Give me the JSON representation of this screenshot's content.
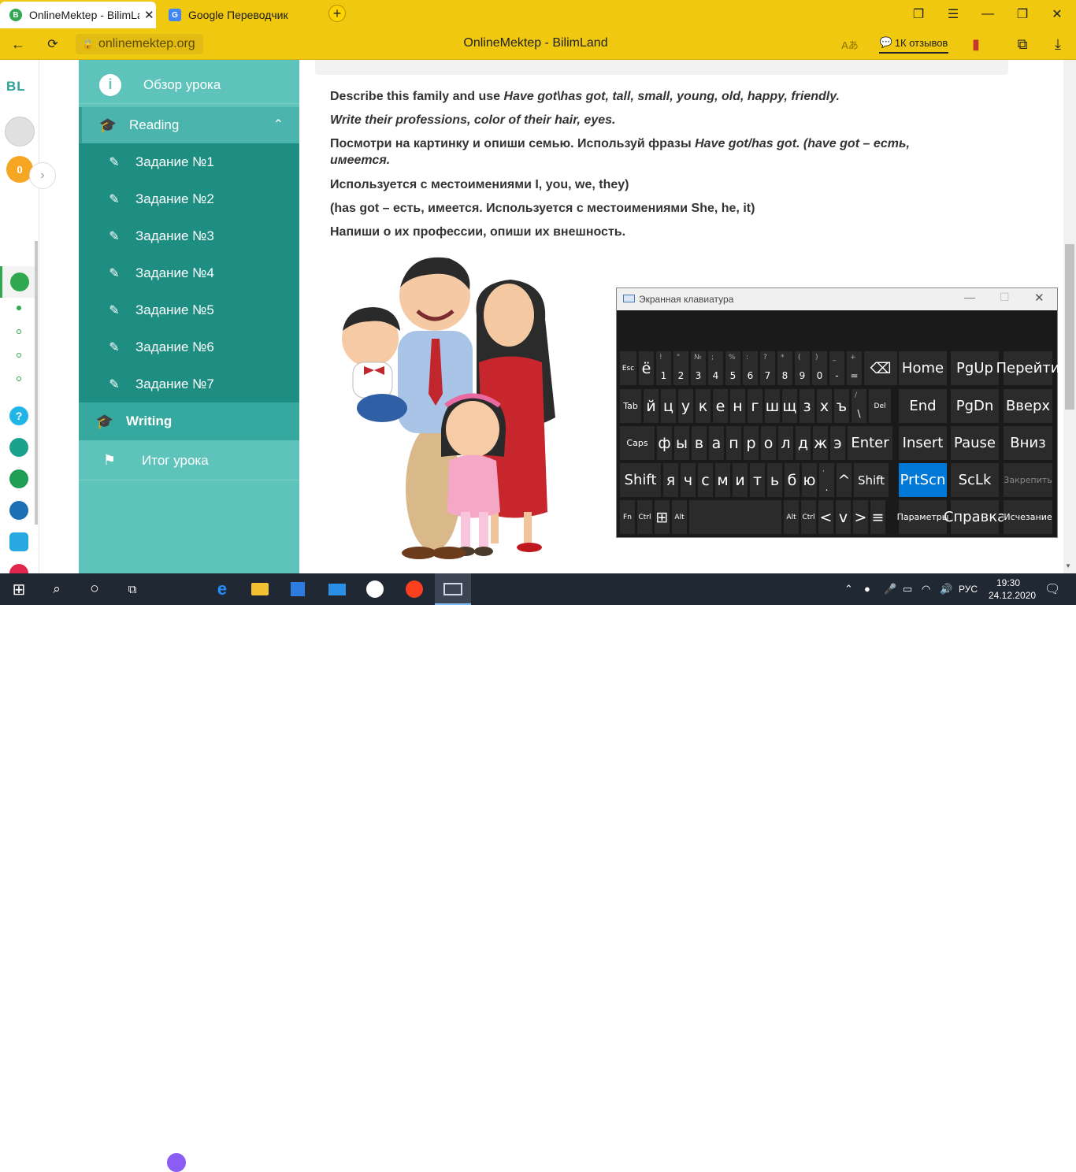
{
  "browser": {
    "tabs": [
      {
        "title": "OnlineMektep - BilimLand",
        "active": true
      },
      {
        "title": "Google Переводчик",
        "active": false
      }
    ],
    "url": "onlinemektep.org",
    "page_title": "OnlineMektep - BilimLand",
    "reviews_label": "1К отзывов"
  },
  "app_sidebar": {
    "logo": "BL",
    "score": "0"
  },
  "menu": {
    "overview": "Обзор урока",
    "reading": "Reading",
    "tasks": [
      "Задание №1",
      "Задание №2",
      "Задание №3",
      "Задание №4",
      "Задание №5",
      "Задание №6",
      "Задание №7"
    ],
    "writing": "Writing",
    "summary": "Итог урока"
  },
  "content": {
    "line1_prefix": "Describe this family and use ",
    "line1_italic": "Have got\\has got, tall, small, young, old, happy, friendly.",
    "line2_italic": "Write their professions, color of their hair, eyes.",
    "line3_prefix": "Посмотри на картинку и опиши семью. Используй фразы ",
    "line3_italic": "Have got/has got. (have got – есть, имеется.",
    "line4": "Используется с местоимениями I, you, we, they)",
    "line5": "(has got – есть, имеется. Используется с местоимениями She, he, it)",
    "line6": "Напиши о их профессии, опиши их внешность."
  },
  "osk": {
    "title": "Экранная клавиатура",
    "row1": [
      {
        "main": "Esc",
        "size": "s"
      },
      {
        "main": "ё",
        "size": "l"
      },
      {
        "main": "1",
        "sup": "!"
      },
      {
        "main": "2",
        "sup": "\""
      },
      {
        "main": "3",
        "sup": "№"
      },
      {
        "main": "4",
        "sup": ";"
      },
      {
        "main": "5",
        "sup": "%"
      },
      {
        "main": "6",
        "sup": ":"
      },
      {
        "main": "7",
        "sup": "?"
      },
      {
        "main": "8",
        "sup": "*"
      },
      {
        "main": "9",
        "sup": "("
      },
      {
        "main": "0",
        "sup": ")"
      },
      {
        "main": "-",
        "sup": "_"
      },
      {
        "main": "=",
        "sup": "+"
      },
      {
        "main": "⌫",
        "size": "l"
      }
    ],
    "row2": [
      {
        "main": "Tab",
        "size": "tiny"
      },
      {
        "main": "й"
      },
      {
        "main": "ц"
      },
      {
        "main": "у"
      },
      {
        "main": "к"
      },
      {
        "main": "е"
      },
      {
        "main": "н"
      },
      {
        "main": "г"
      },
      {
        "main": "ш"
      },
      {
        "main": "щ"
      },
      {
        "main": "з"
      },
      {
        "main": "х"
      },
      {
        "main": "ъ"
      },
      {
        "main": "\\",
        "sup": "/"
      },
      {
        "main": "Del",
        "size": "s"
      }
    ],
    "row3": [
      {
        "main": "Caps",
        "size": "tiny"
      },
      {
        "main": "ф"
      },
      {
        "main": "ы"
      },
      {
        "main": "в"
      },
      {
        "main": "а"
      },
      {
        "main": "п"
      },
      {
        "main": "р"
      },
      {
        "main": "о"
      },
      {
        "main": "л"
      },
      {
        "main": "д"
      },
      {
        "main": "ж"
      },
      {
        "main": "э"
      },
      {
        "main": "Enter",
        "size": "fn"
      }
    ],
    "row4": [
      {
        "main": "Shift",
        "size": "fn"
      },
      {
        "main": "я"
      },
      {
        "main": "ч"
      },
      {
        "main": "с"
      },
      {
        "main": "м"
      },
      {
        "main": "и"
      },
      {
        "main": "т"
      },
      {
        "main": "ь"
      },
      {
        "main": "б"
      },
      {
        "main": "ю"
      },
      {
        "main": ".",
        "sup": ","
      },
      {
        "main": "^"
      },
      {
        "main": "Shift",
        "size": "m"
      }
    ],
    "row5": [
      {
        "main": "Fn",
        "size": "s"
      },
      {
        "main": "Ctrl",
        "size": "s"
      },
      {
        "main": "⊞"
      },
      {
        "main": "Alt",
        "size": "s"
      },
      {
        "main": ""
      },
      {
        "main": "Alt",
        "size": "s"
      },
      {
        "main": "Ctrl",
        "size": "s"
      },
      {
        "main": "<"
      },
      {
        "main": "v"
      },
      {
        "main": ">"
      },
      {
        "main": "≡"
      }
    ],
    "nav": [
      [
        "Home",
        "PgUp",
        "Перейти"
      ],
      [
        "End",
        "PgDn",
        "Вверх"
      ],
      [
        "Insert",
        "Pause",
        "Вниз"
      ],
      [
        "PrtScn",
        "ScLk",
        "Закрепить"
      ],
      [
        "Параметры",
        "Справка",
        "Исчезание"
      ]
    ],
    "accent": "#0078d7"
  },
  "taskbar": {
    "lang": "РУС",
    "time": "19:30",
    "date": "24.12.2020"
  },
  "colors": {
    "browser_yellow": "#f0c80f",
    "menu_teal": "#5dc3bb",
    "menu_sub": "#1e8e83",
    "taskbar": "#202833"
  }
}
